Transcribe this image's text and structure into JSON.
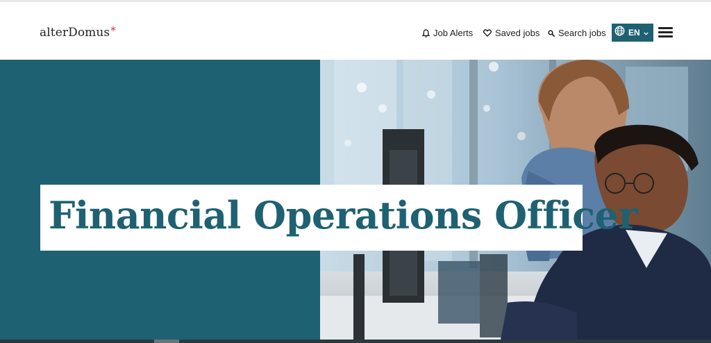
{
  "header": {
    "logo_text": "alterDomus",
    "logo_mark": "*",
    "nav": {
      "job_alerts": "Job Alerts",
      "saved_jobs": "Saved jobs",
      "search_jobs": "Search jobs"
    },
    "language": "EN",
    "icons": {
      "alerts": "bell-icon",
      "saved": "heart-icon",
      "search": "search-icon",
      "language": "globe-icon",
      "language_caret": "chevron-down-icon",
      "menu": "hamburger-menu-icon"
    }
  },
  "hero": {
    "title": "Financial Operations Officer",
    "image": "office-photo"
  },
  "colors": {
    "brand_teal": "#1e6172",
    "logo_star": "#d9322b",
    "text_dark": "#222222"
  }
}
